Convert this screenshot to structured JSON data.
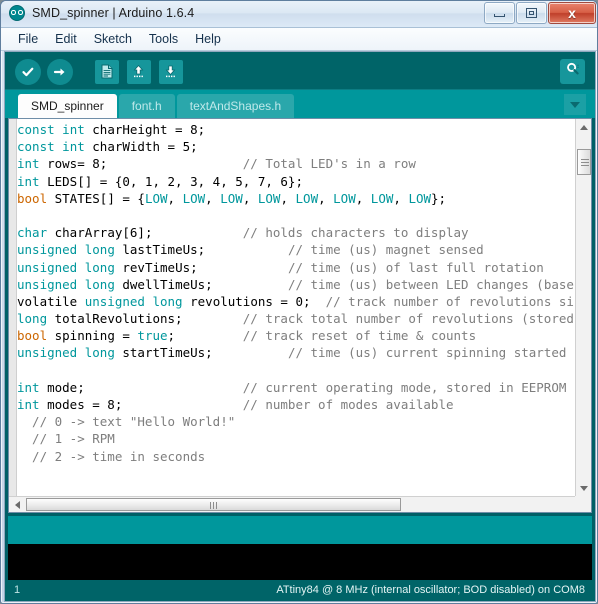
{
  "window": {
    "title": "SMD_spinner | Arduino 1.6.4",
    "logo_icon": "arduino-logo-icon",
    "minimize_label": "",
    "maximize_label": "",
    "close_label": "x"
  },
  "menubar": {
    "items": [
      {
        "label": "File"
      },
      {
        "label": "Edit"
      },
      {
        "label": "Sketch"
      },
      {
        "label": "Tools"
      },
      {
        "label": "Help"
      }
    ]
  },
  "toolbar": {
    "buttons": [
      {
        "name": "verify-button",
        "icon": "check-icon",
        "glyph": "✔"
      },
      {
        "name": "upload-button",
        "icon": "arrow-right-icon",
        "glyph": "➜"
      },
      {
        "name": "new-button",
        "icon": "new-document-icon",
        "glyph": "❐"
      },
      {
        "name": "open-button",
        "icon": "arrow-up-icon",
        "glyph": "↑"
      },
      {
        "name": "save-button",
        "icon": "arrow-down-icon",
        "glyph": "↓"
      }
    ],
    "serial_monitor": {
      "name": "serial-monitor-button",
      "icon": "magnifier-icon",
      "glyph": "⌕"
    }
  },
  "tabs": {
    "items": [
      {
        "label": "SMD_spinner",
        "active": true
      },
      {
        "label": "font.h",
        "active": false
      },
      {
        "label": "textAndShapes.h",
        "active": false
      }
    ],
    "menu_icon": "chevron-down-icon"
  },
  "editor": {
    "lines": [
      [
        {
          "t": "const",
          "c": "kw"
        },
        {
          "t": " ",
          "c": ""
        },
        {
          "t": "int",
          "c": "kw"
        },
        {
          "t": " charHeight = 8;",
          "c": ""
        }
      ],
      [
        {
          "t": "const",
          "c": "kw"
        },
        {
          "t": " ",
          "c": ""
        },
        {
          "t": "int",
          "c": "kw"
        },
        {
          "t": " charWidth = 5;",
          "c": ""
        }
      ],
      [
        {
          "t": "int",
          "c": "kw"
        },
        {
          "t": " rows= 8;                  ",
          "c": ""
        },
        {
          "t": "// Total LED's in a row",
          "c": "cm"
        }
      ],
      [
        {
          "t": "int",
          "c": "kw"
        },
        {
          "t": " LEDS[] = {0, 1, 2, 3, 4, 5, 7, 6};",
          "c": ""
        }
      ],
      [
        {
          "t": "bool",
          "c": "kw2"
        },
        {
          "t": " STATES[] = {",
          "c": ""
        },
        {
          "t": "LOW",
          "c": "lit"
        },
        {
          "t": ", ",
          "c": ""
        },
        {
          "t": "LOW",
          "c": "lit"
        },
        {
          "t": ", ",
          "c": ""
        },
        {
          "t": "LOW",
          "c": "lit"
        },
        {
          "t": ", ",
          "c": ""
        },
        {
          "t": "LOW",
          "c": "lit"
        },
        {
          "t": ", ",
          "c": ""
        },
        {
          "t": "LOW",
          "c": "lit"
        },
        {
          "t": ", ",
          "c": ""
        },
        {
          "t": "LOW",
          "c": "lit"
        },
        {
          "t": ", ",
          "c": ""
        },
        {
          "t": "LOW",
          "c": "lit"
        },
        {
          "t": ", ",
          "c": ""
        },
        {
          "t": "LOW",
          "c": "lit"
        },
        {
          "t": "};",
          "c": ""
        }
      ],
      [
        {
          "t": "",
          "c": ""
        }
      ],
      [
        {
          "t": "char",
          "c": "kw"
        },
        {
          "t": " charArray[6];            ",
          "c": ""
        },
        {
          "t": "// holds characters to display",
          "c": "cm"
        }
      ],
      [
        {
          "t": "unsigned",
          "c": "kw"
        },
        {
          "t": " ",
          "c": ""
        },
        {
          "t": "long",
          "c": "kw"
        },
        {
          "t": " lastTimeUs;           ",
          "c": ""
        },
        {
          "t": "// time (us) magnet sensed",
          "c": "cm"
        }
      ],
      [
        {
          "t": "unsigned",
          "c": "kw"
        },
        {
          "t": " ",
          "c": ""
        },
        {
          "t": "long",
          "c": "kw"
        },
        {
          "t": " revTimeUs;            ",
          "c": ""
        },
        {
          "t": "// time (us) of last full rotation",
          "c": "cm"
        }
      ],
      [
        {
          "t": "unsigned",
          "c": "kw"
        },
        {
          "t": " ",
          "c": ""
        },
        {
          "t": "long",
          "c": "kw"
        },
        {
          "t": " dwellTimeUs;          ",
          "c": ""
        },
        {
          "t": "// time (us) between LED changes (based",
          "c": "cm"
        }
      ],
      [
        {
          "t": "volatile ",
          "c": ""
        },
        {
          "t": "unsigned",
          "c": "kw"
        },
        {
          "t": " ",
          "c": ""
        },
        {
          "t": "long",
          "c": "kw"
        },
        {
          "t": " revolutions = 0;  ",
          "c": ""
        },
        {
          "t": "// track number of revolutions since la",
          "c": "cm"
        }
      ],
      [
        {
          "t": "long",
          "c": "kw"
        },
        {
          "t": " totalRevolutions;        ",
          "c": ""
        },
        {
          "t": "// track total number of revolutions (stored in",
          "c": "cm"
        }
      ],
      [
        {
          "t": "bool",
          "c": "kw2"
        },
        {
          "t": " spinning = ",
          "c": ""
        },
        {
          "t": "true",
          "c": "lit"
        },
        {
          "t": ";         ",
          "c": ""
        },
        {
          "t": "// track reset of time & counts",
          "c": "cm"
        }
      ],
      [
        {
          "t": "unsigned",
          "c": "kw"
        },
        {
          "t": " ",
          "c": ""
        },
        {
          "t": "long",
          "c": "kw"
        },
        {
          "t": " startTimeUs;          ",
          "c": ""
        },
        {
          "t": "// time (us) current spinning started",
          "c": "cm"
        }
      ],
      [
        {
          "t": "",
          "c": ""
        }
      ],
      [
        {
          "t": "int",
          "c": "kw"
        },
        {
          "t": " mode;                     ",
          "c": ""
        },
        {
          "t": "// current operating mode, stored in EEPROM",
          "c": "cm"
        }
      ],
      [
        {
          "t": "int",
          "c": "kw"
        },
        {
          "t": " modes = 8;                ",
          "c": ""
        },
        {
          "t": "// number of modes available",
          "c": "cm"
        }
      ],
      [
        {
          "t": "  // 0 -> text \"Hello World!\"",
          "c": "cm"
        }
      ],
      [
        {
          "t": "  // 1 -> RPM",
          "c": "cm"
        }
      ],
      [
        {
          "t": "  // 2 -> time in seconds",
          "c": "cm"
        }
      ]
    ]
  },
  "console": {
    "text": ""
  },
  "statusbar": {
    "line_number": "1",
    "board_info": "ATtiny84 @ 8 MHz  (internal oscillator; BOD disabled) on COM8"
  },
  "colors": {
    "teal": "#00979c",
    "teal_dark": "#006468",
    "keyword": "#00979c",
    "keyword_alt": "#cc6600",
    "comment": "#7e7e7e",
    "console_bg": "#000000"
  }
}
